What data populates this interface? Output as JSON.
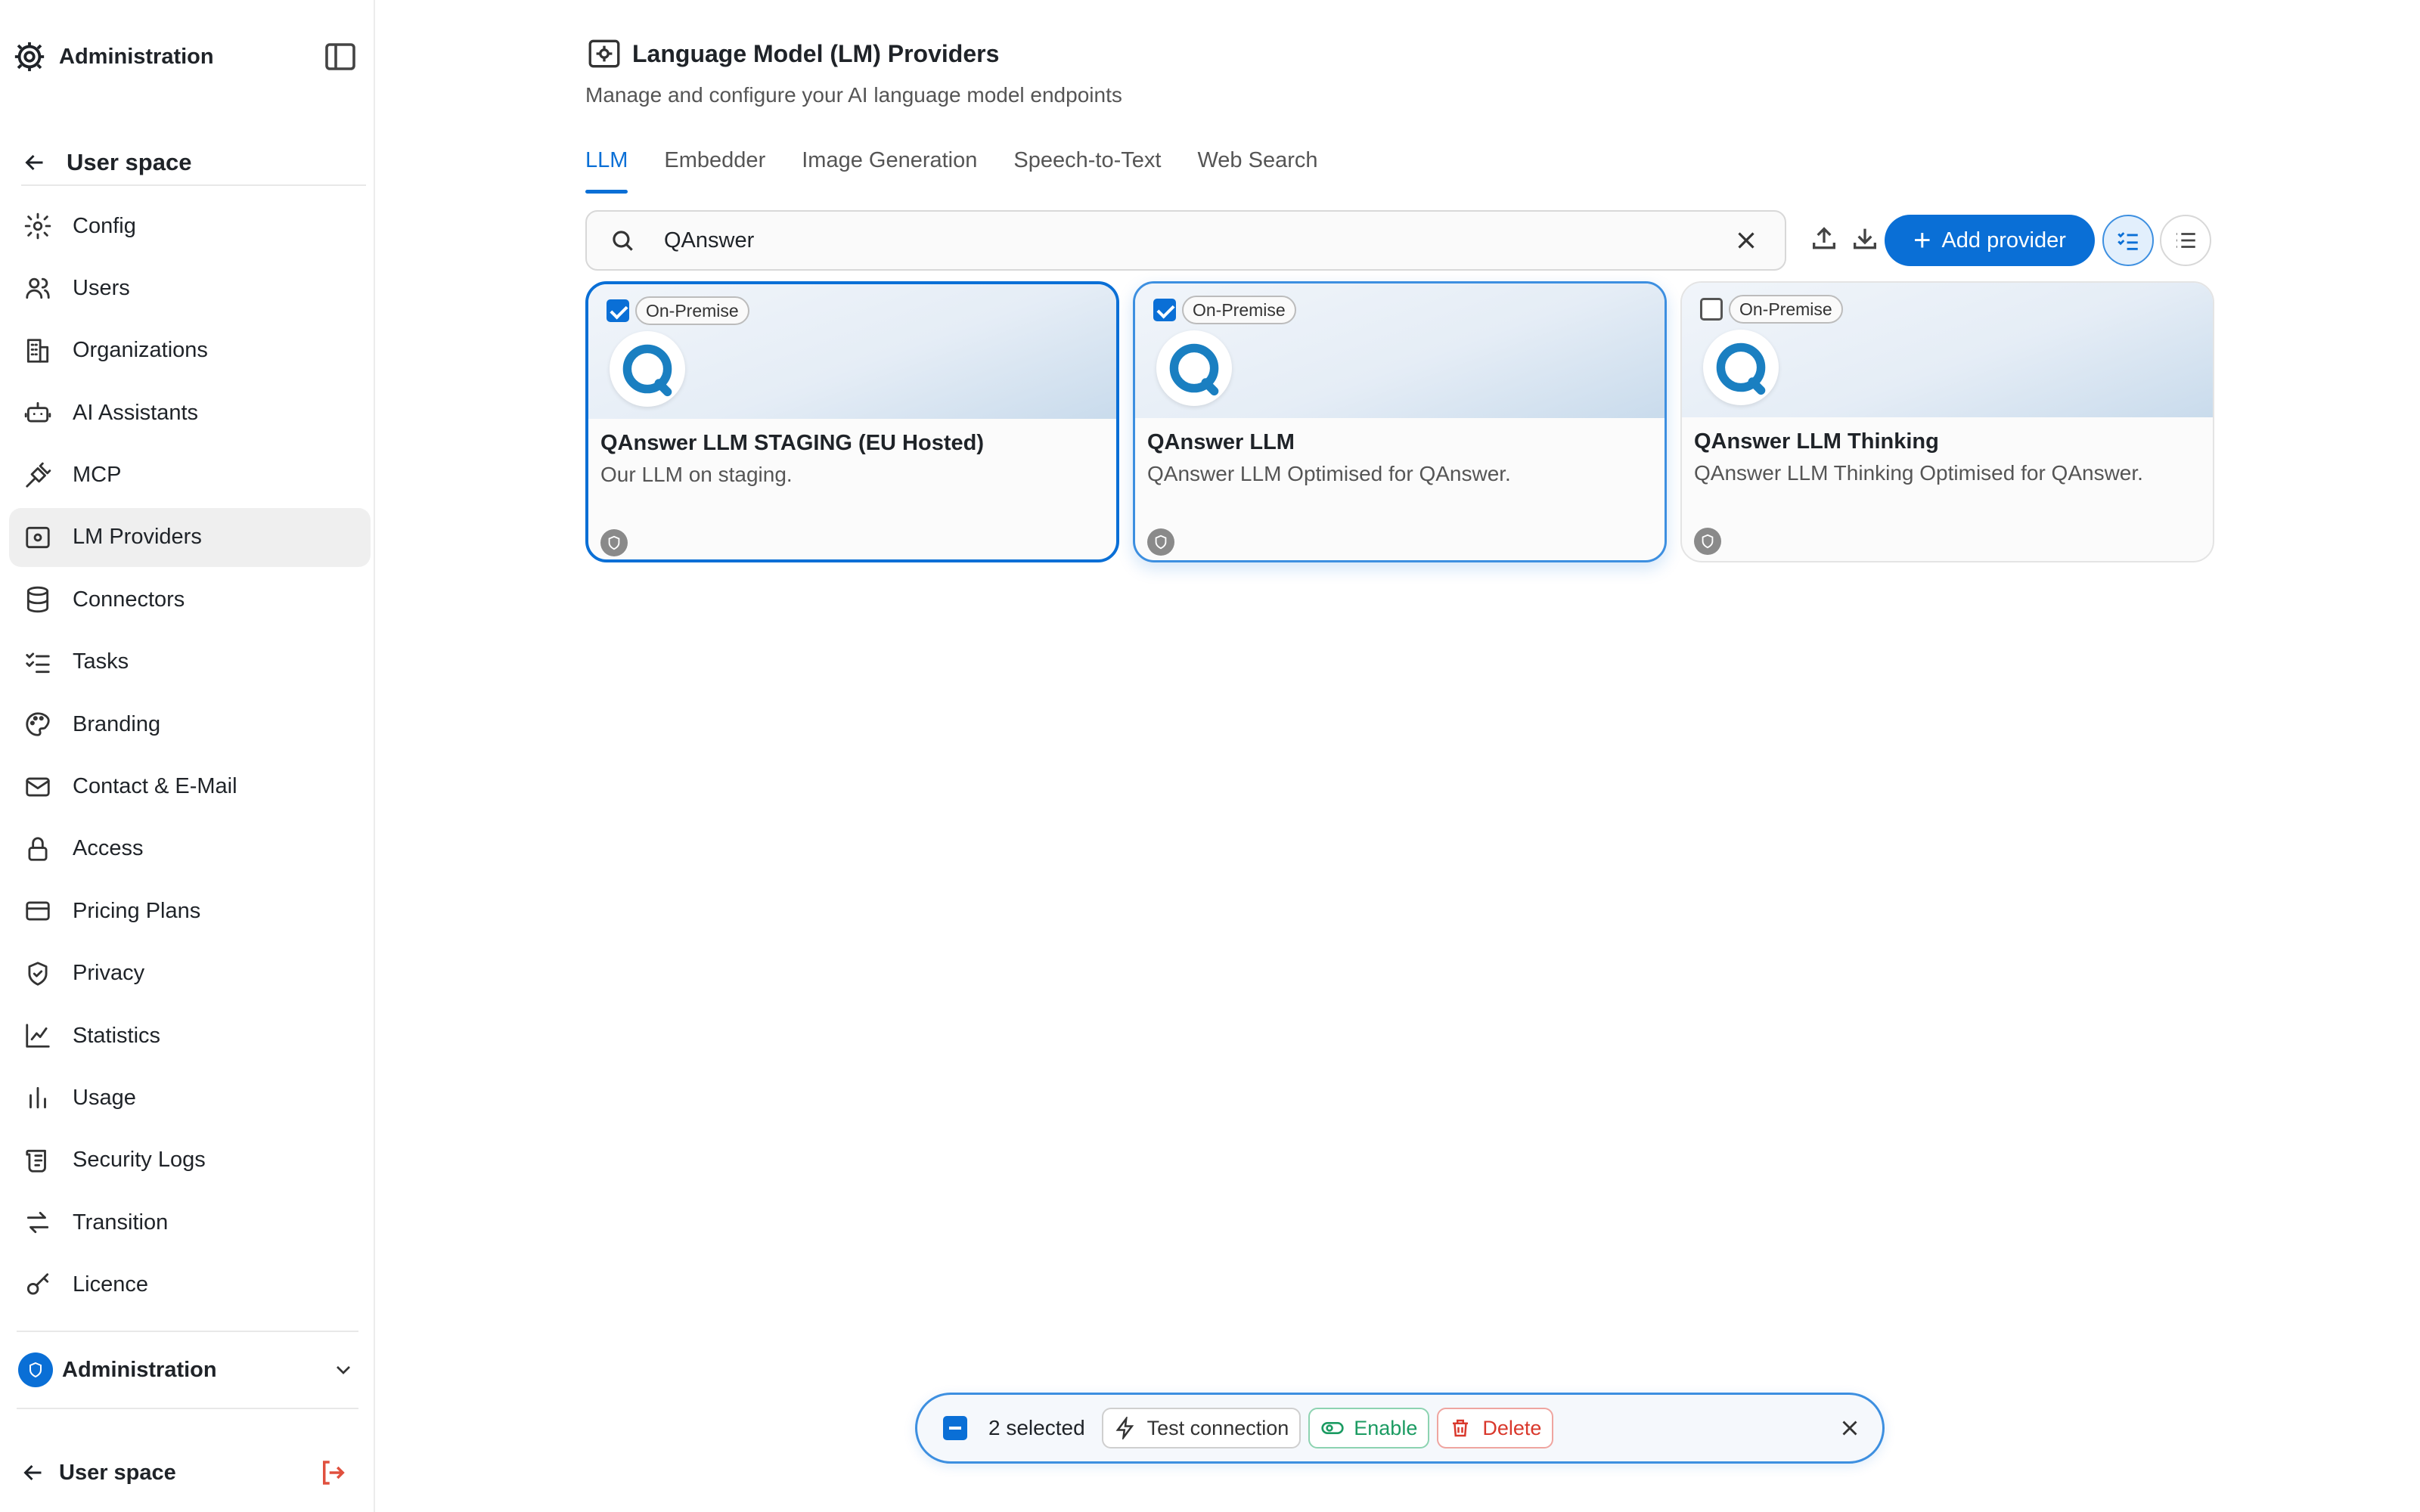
{
  "sidebar": {
    "title": "Administration",
    "back_label": "User space",
    "items": [
      {
        "label": "Config",
        "icon": "gear-icon"
      },
      {
        "label": "Users",
        "icon": "users-icon"
      },
      {
        "label": "Organizations",
        "icon": "building-icon"
      },
      {
        "label": "AI Assistants",
        "icon": "bot-icon"
      },
      {
        "label": "MCP",
        "icon": "plug-icon"
      },
      {
        "label": "LM Providers",
        "icon": "cpu-icon",
        "active": true
      },
      {
        "label": "Connectors",
        "icon": "database-icon"
      },
      {
        "label": "Tasks",
        "icon": "list-check-icon"
      },
      {
        "label": "Branding",
        "icon": "palette-icon"
      },
      {
        "label": "Contact & E-Mail",
        "icon": "mail-icon"
      },
      {
        "label": "Access",
        "icon": "lock-icon"
      },
      {
        "label": "Pricing Plans",
        "icon": "credit-card-icon"
      },
      {
        "label": "Privacy",
        "icon": "shield-check-icon"
      },
      {
        "label": "Statistics",
        "icon": "line-chart-icon"
      },
      {
        "label": "Usage",
        "icon": "bar-chart-icon"
      },
      {
        "label": "Security Logs",
        "icon": "scroll-icon"
      },
      {
        "label": "Transition",
        "icon": "arrows-swap-icon"
      },
      {
        "label": "Licence",
        "icon": "key-icon"
      }
    ],
    "org_label": "Administration",
    "footer_label": "User space"
  },
  "page": {
    "title": "Language Model (LM) Providers",
    "subtitle": "Manage and configure your AI language model endpoints"
  },
  "tabs": [
    "LLM",
    "Embedder",
    "Image Generation",
    "Speech-to-Text",
    "Web Search"
  ],
  "active_tab": "LLM",
  "search": {
    "value": "QAnswer"
  },
  "toolbar": {
    "add_label": "Add provider"
  },
  "cards": [
    {
      "tag": "On-Premise",
      "name": "QAnswer LLM STAGING (EU Hosted)",
      "description": "Our LLM on staging.",
      "checked": true
    },
    {
      "tag": "On-Premise",
      "name": "QAnswer LLM",
      "description": "QAnswer LLM Optimised for QAnswer.",
      "checked": true
    },
    {
      "tag": "On-Premise",
      "name": "QAnswer LLM Thinking",
      "description": "QAnswer LLM Thinking Optimised for QAnswer.",
      "checked": false
    }
  ],
  "bulk": {
    "count_label": "2 selected",
    "test_label": "Test connection",
    "enable_label": "Enable",
    "delete_label": "Delete"
  },
  "colors": {
    "accent": "#0a6fd6",
    "enable": "#1b9b62",
    "delete": "#d9382c"
  }
}
